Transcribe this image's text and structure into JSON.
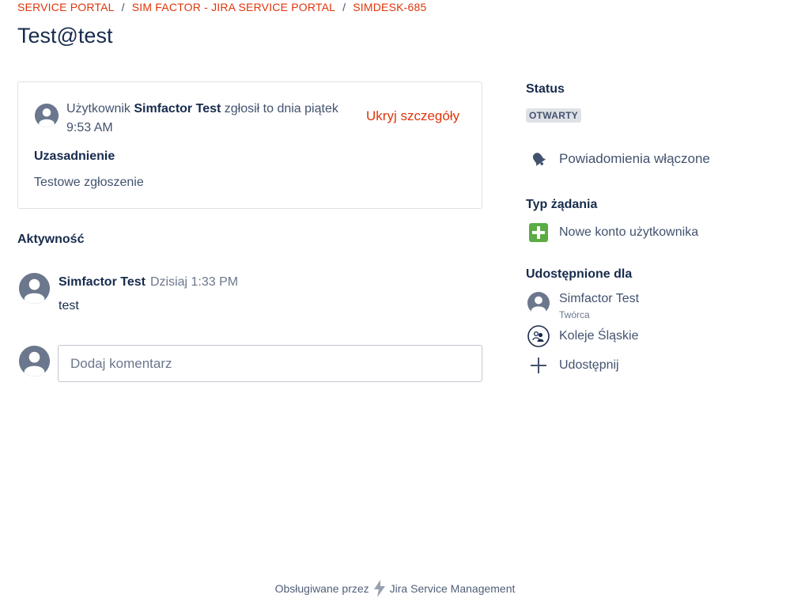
{
  "breadcrumb": {
    "items": [
      "SERVICE PORTAL",
      "SIM FACTOR - JIRA SERVICE PORTAL",
      "SIMDESK-685"
    ],
    "separator": "/"
  },
  "page_title": "Test@test",
  "details": {
    "reporter_prefix": "Użytkownik ",
    "reporter_name": "Simfactor Test",
    "reporter_suffix": " zgłosił to dnia piątek 9:53 AM",
    "hide_details_label": "Ukryj szczegóły",
    "field_label": "Uzasadnienie",
    "field_value": "Testowe zgłoszenie"
  },
  "activity": {
    "heading": "Aktywność",
    "entries": [
      {
        "author": "Simfactor Test",
        "time": "Dzisiaj 1:33 PM",
        "body": "test"
      }
    ],
    "comment_placeholder": "Dodaj komentarz"
  },
  "sidebar": {
    "status_heading": "Status",
    "status_value": "OTWARTY",
    "notifications_label": "Powiadomienia włączone",
    "request_type_heading": "Typ żądania",
    "request_type_value": "Nowe konto użytkownika",
    "shared_heading": "Udostępnione dla",
    "shared": [
      {
        "name": "Simfactor Test",
        "role": "Twórca"
      },
      {
        "name": "Koleje Śląskie"
      }
    ],
    "share_label": "Udostępnij"
  },
  "footer": {
    "prefix": "Obsługiwane przez",
    "product": "Jira Service Management"
  },
  "colors": {
    "link": "#de350b",
    "text_primary": "#172b4d",
    "text_secondary": "#42526e",
    "request_type_icon": "#5aac44",
    "avatar": "#6b778c"
  }
}
